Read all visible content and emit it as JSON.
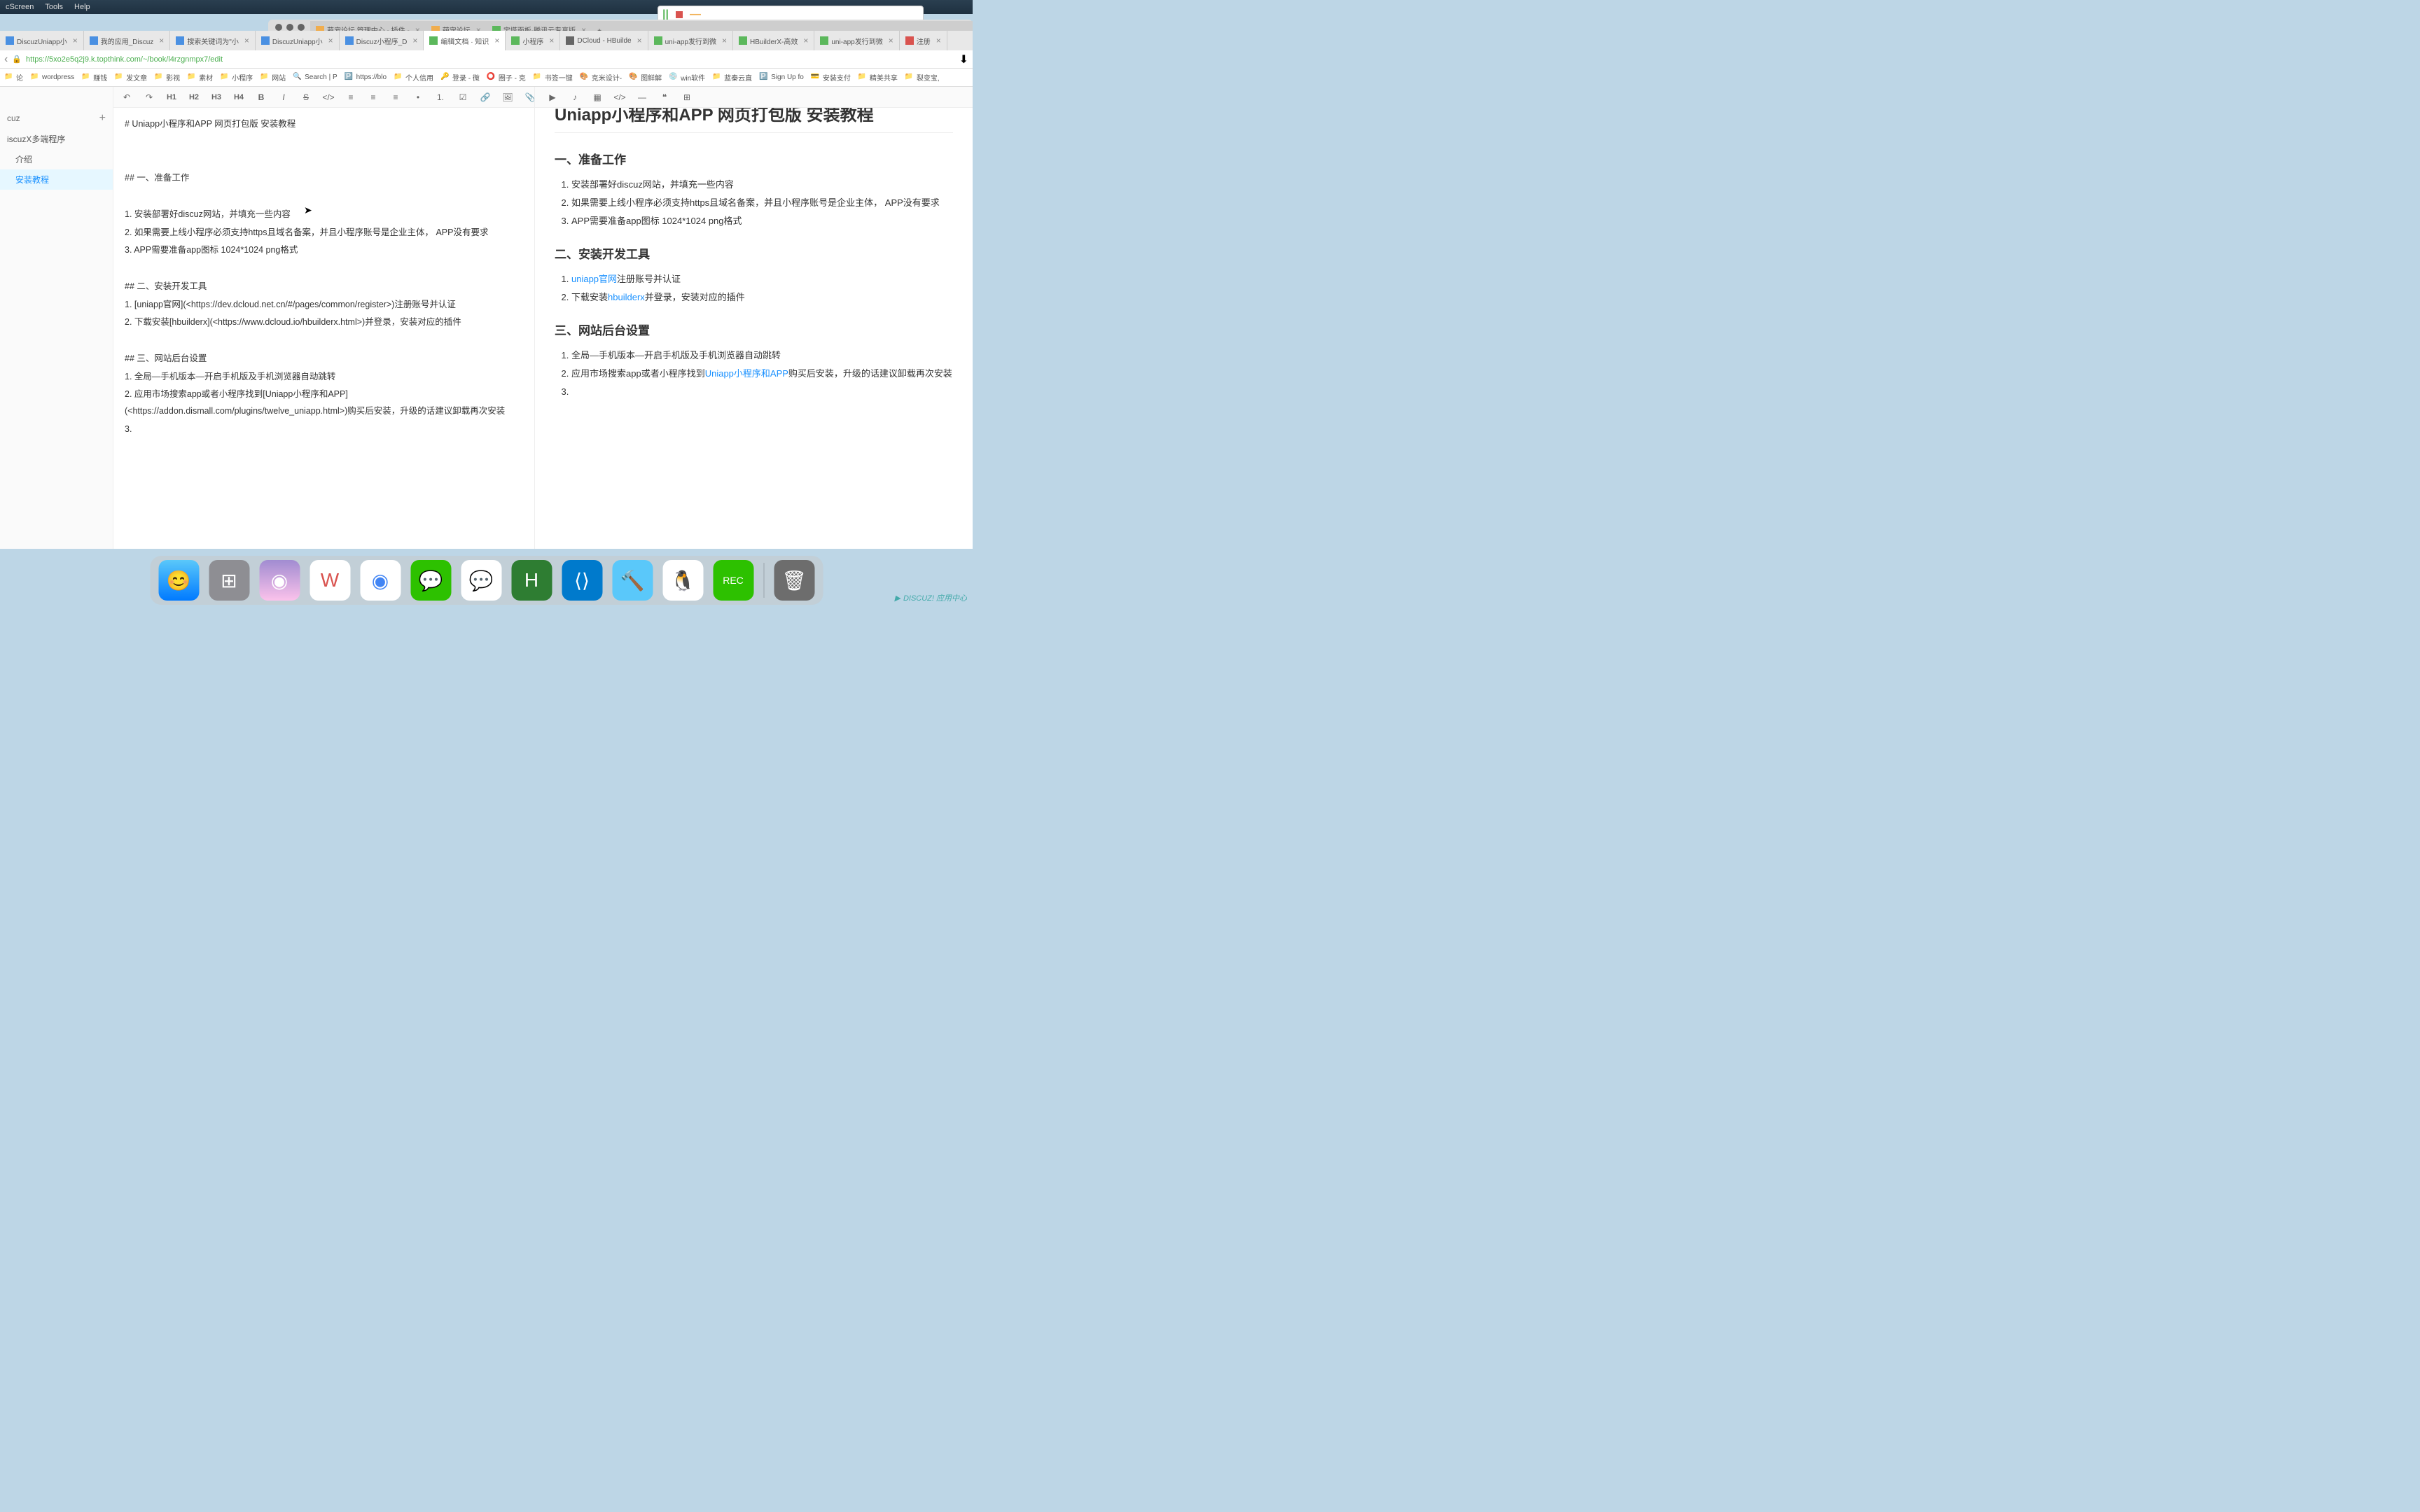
{
  "menubar": {
    "items": [
      "cScreen",
      "Tools",
      "Help"
    ]
  },
  "topTabs": [
    {
      "label": "萌宠论坛 管理中心 - 插件 -",
      "active": false
    },
    {
      "label": "萌宠论坛",
      "active": false
    },
    {
      "label": "宝塔面板-腾讯云专享版",
      "active": false
    }
  ],
  "innerTabs": [
    {
      "label": "DiscuzUniapp小",
      "color": "#4a90e2"
    },
    {
      "label": "我的应用_Discuz",
      "color": "#4a90e2"
    },
    {
      "label": "搜索关键词为\"小",
      "color": "#4a90e2"
    },
    {
      "label": "DiscuzUniapp小",
      "color": "#4a90e2"
    },
    {
      "label": "Discuz小程序_D",
      "color": "#4a90e2"
    },
    {
      "label": "编辑文档 · 知识",
      "color": "#5cb85c",
      "active": true
    },
    {
      "label": "小程序",
      "color": "#5cb85c"
    },
    {
      "label": "DCloud - HBuilde",
      "color": "#666"
    },
    {
      "label": "uni-app发行到微",
      "color": "#5cb85c"
    },
    {
      "label": "HBuilderX-高效",
      "color": "#5cb85c"
    },
    {
      "label": "uni-app发行到微",
      "color": "#5cb85c"
    },
    {
      "label": "注册",
      "color": "#d9534f"
    }
  ],
  "url": "https://5xo2e5q2j9.k.topthink.com/~/book/l4rzgnmpx7/edit",
  "bookmarks": [
    {
      "label": "论",
      "icon": "📁"
    },
    {
      "label": "wordpress",
      "icon": "📁"
    },
    {
      "label": "赚钱",
      "icon": "📁"
    },
    {
      "label": "发文章",
      "icon": "📁"
    },
    {
      "label": "影视",
      "icon": "📁"
    },
    {
      "label": "素材",
      "icon": "📁"
    },
    {
      "label": "小程序",
      "icon": "📁"
    },
    {
      "label": "网站",
      "icon": "📁"
    },
    {
      "label": "Search | P",
      "icon": "🔍"
    },
    {
      "label": "https://blo",
      "icon": "🅿️"
    },
    {
      "label": "个人信用",
      "icon": "📁"
    },
    {
      "label": "登录 - 微",
      "icon": "🔑"
    },
    {
      "label": "圈子 - 克",
      "icon": "⭕"
    },
    {
      "label": "书签一键",
      "icon": "📁"
    },
    {
      "label": "克米设计-",
      "icon": "🎨"
    },
    {
      "label": "图鲜解",
      "icon": "🎨"
    },
    {
      "label": "win软件",
      "icon": "💿"
    },
    {
      "label": "蓝秦云直",
      "icon": "📁"
    },
    {
      "label": "Sign Up fo",
      "icon": "🅿️"
    },
    {
      "label": "安装支付",
      "icon": "💳"
    },
    {
      "label": "精美共享",
      "icon": "📁"
    },
    {
      "label": "裂变宝,",
      "icon": "📁"
    }
  ],
  "sidebar": {
    "title": "cuz",
    "root": "iscuzX多端程序",
    "items": [
      {
        "label": "介绍",
        "active": false
      },
      {
        "label": "安装教程",
        "active": true
      }
    ]
  },
  "toolbar": {
    "h1": "H1",
    "h2": "H2",
    "h3": "H3",
    "h4": "H4"
  },
  "editorLines": [
    "# Uniapp小程序和APP 网页打包版 安装教程",
    "",
    "",
    "## 一、准备工作",
    "",
    "1. 安装部署好discuz网站，并填充一些内容",
    "2. 如果需要上线小程序必须支持https且域名备案，并且小程序账号是企业主体， APP没有要求",
    "3. APP需要准备app图标 1024*1024 png格式",
    "",
    "## 二、安装开发工具",
    "1. [uniapp官网](<https://dev.dcloud.net.cn/#/pages/common/register>)注册账号并认证",
    "2. 下载安装[hbuilderx](<https://www.dcloud.io/hbuilderx.html>)并登录，安装对应的插件",
    "",
    "##  三、网站后台设置",
    "1. 全局—手机版本—开启手机版及手机浏览器自动跳转",
    "2. 应用市场搜索app或者小程序找到[Uniapp小程序和APP](<https://addon.dismall.com/plugins/twelve_uniapp.html>)购买后安装，升级的话建议卸载再次安装",
    "3. "
  ],
  "preview": {
    "title": "Uniapp小程序和APP 网页打包版 安装教程",
    "s1": {
      "heading": "一、准备工作",
      "items": [
        "安装部署好discuz网站，并填充一些内容",
        "如果需要上线小程序必须支持https且域名备案，并且小程序账号是企业主体， APP没有要求",
        "APP需要准备app图标 1024*1024 png格式"
      ]
    },
    "s2": {
      "heading": "二、安装开发工具",
      "i1a": "uniapp官网",
      "i1b": "注册账号并认证",
      "i2a": "下载安装",
      "i2b": "hbuilderx",
      "i2c": "并登录，安装对应的插件"
    },
    "s3": {
      "heading": "三、网站后台设置",
      "i1": "全局—手机版本—开启手机版及手机浏览器自动跳转",
      "i2a": "应用市场搜索app或者小程序找到",
      "i2b": "Uniapp小程序和APP",
      "i2c": "购买后安装，升级的话建议卸载再次安装",
      "i3": ""
    }
  },
  "dock": [
    {
      "name": "finder",
      "bg": "linear-gradient(#5ac8fa,#007aff)",
      "glyph": "😊"
    },
    {
      "name": "launchpad",
      "bg": "#8e8e93",
      "glyph": "⊞"
    },
    {
      "name": "app3",
      "bg": "linear-gradient(#a18cd1,#fbc2eb)",
      "glyph": "◉"
    },
    {
      "name": "wps",
      "bg": "#fff",
      "glyph": "W",
      "color": "#d9534f"
    },
    {
      "name": "chrome",
      "bg": "#fff",
      "glyph": "◉",
      "color": "#4285f4"
    },
    {
      "name": "wechat",
      "bg": "#2dc100",
      "glyph": "💬"
    },
    {
      "name": "wework",
      "bg": "#fff",
      "glyph": "💬",
      "color": "#4a90e2"
    },
    {
      "name": "hbuilder",
      "bg": "#2e7d32",
      "glyph": "H"
    },
    {
      "name": "vscode",
      "bg": "#007acc",
      "glyph": "⟨⟩"
    },
    {
      "name": "xcode",
      "bg": "#5ac8fa",
      "glyph": "🔨"
    },
    {
      "name": "qq",
      "bg": "#fff",
      "glyph": "🐧"
    },
    {
      "name": "rec",
      "bg": "#2dc100",
      "glyph": "REC",
      "fs": "14px"
    },
    {
      "name": "trash",
      "bg": "#6d6d6d",
      "glyph": "🗑"
    }
  ],
  "watermark": "DISCUZ! 应用中心"
}
